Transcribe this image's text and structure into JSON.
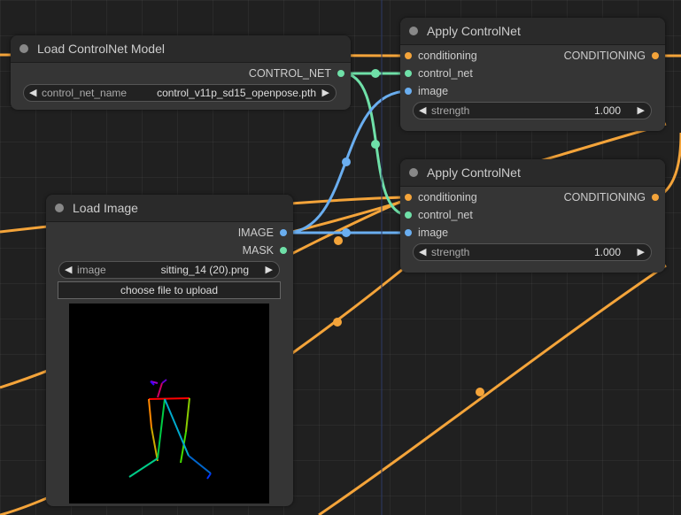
{
  "nodes": {
    "load_controlnet": {
      "title": "Load ControlNet Model",
      "output": "CONTROL_NET",
      "widget": {
        "label": "control_net_name",
        "value": "control_v11p_sd15_openpose.pth"
      }
    },
    "apply1": {
      "title": "Apply ControlNet",
      "inputs": [
        "conditioning",
        "control_net",
        "image"
      ],
      "output": "CONDITIONING",
      "widget": {
        "label": "strength",
        "value": "1.000"
      }
    },
    "apply2": {
      "title": "Apply ControlNet",
      "inputs": [
        "conditioning",
        "control_net",
        "image"
      ],
      "output": "CONDITIONING",
      "widget": {
        "label": "strength",
        "value": "1.000"
      }
    },
    "load_image": {
      "title": "Load Image",
      "outputs": [
        "IMAGE",
        "MASK"
      ],
      "widget": {
        "label": "image",
        "value": "sitting_14 (20).png"
      },
      "upload_label": "choose file to upload"
    }
  },
  "colors": {
    "conditioning": "#f4a43a",
    "control_net": "#6fe0a8",
    "image": "#6aaef0",
    "canvas": "#202020",
    "node": "#353535"
  },
  "icons": {
    "arrow_left": "◀",
    "arrow_right": "▶"
  }
}
